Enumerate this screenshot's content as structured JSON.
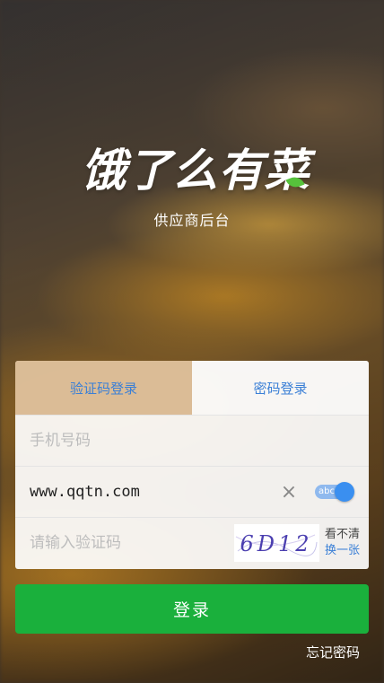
{
  "app": {
    "logo_text": "饿了么有菜",
    "subtitle": "供应商后台"
  },
  "tabs": [
    {
      "label": "验证码登录",
      "active": false
    },
    {
      "label": "密码登录",
      "active": true
    }
  ],
  "form": {
    "phone_placeholder": "手机号码",
    "password_value": "www.qqtn.com",
    "clear_icon": "×",
    "toggle_label": "abc",
    "captcha_placeholder": "请输入验证码",
    "captcha_text": "6D12",
    "captcha_unclear": "看不清",
    "captcha_change": "换一张"
  },
  "actions": {
    "login_label": "登录",
    "forgot_label": "忘记密码"
  },
  "colors": {
    "accent_blue": "#3a7fd6",
    "login_green": "#1ab03c",
    "leaf_green": "#56c23b"
  }
}
